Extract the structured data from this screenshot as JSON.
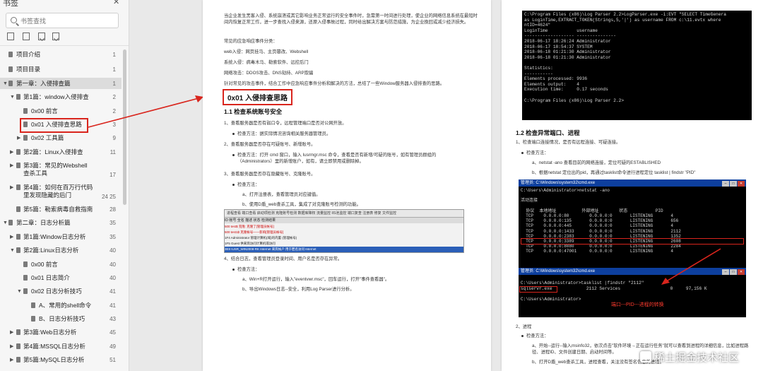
{
  "sidebar": {
    "title": "书签",
    "close": "✕",
    "search_placeholder": "书签查找",
    "items": [
      {
        "label": "项目介绍",
        "page": "1"
      },
      {
        "label": "项目目录",
        "page": "1"
      },
      {
        "label": "第一章：入侵排查篇",
        "page": "1"
      },
      {
        "label": "第1篇：window入侵排查",
        "page": "2"
      },
      {
        "label": "0x00 前言",
        "page": "2"
      },
      {
        "label": "0x01 入侵排查思路",
        "page": "3"
      },
      {
        "label": "0x02 工具篇",
        "page": "9"
      },
      {
        "label": "第2篇：Linux入侵排查",
        "page": "11"
      },
      {
        "label": "第3篇：常见的Webshell\n查杀工具",
        "page": "17"
      },
      {
        "label": "第4篇：如何在百万行代码\n里发现隐藏的后门",
        "page": "24\n25"
      },
      {
        "label": "第5篇：勒索病毒自救指南",
        "page": "28"
      },
      {
        "label": "第二章：日志分析篇",
        "page": "35"
      },
      {
        "label": "第1篇:Window日志分析",
        "page": "35"
      },
      {
        "label": "第2篇:Linux日志分析",
        "page": "40"
      },
      {
        "label": "0x00 前言",
        "page": "40"
      },
      {
        "label": "0x01 日志简介",
        "page": "40"
      },
      {
        "label": "0x02 日志分析技巧",
        "page": "41"
      },
      {
        "label": "A、常用的shell命令",
        "page": "41"
      },
      {
        "label": "B、日志分析技巧",
        "page": "43"
      },
      {
        "label": "第3篇:Web日志分析",
        "page": "45"
      },
      {
        "label": "第4篇:MSSQL日志分析",
        "page": "49"
      },
      {
        "label": "第5篇:MySQL日志分析",
        "page": "51"
      }
    ]
  },
  "page1": {
    "intro": "当企业发生黑客入侵、系统崩溃或其它影响业务正常运行的安全事件时，急需第一时间进行处理，使企业的网络信息系统在最短时间内恢复正常工作，进一步查找入侵来源，还原入侵事故过程，同时给出解决方案与防范措施，为企业挽回或减少经济损失。",
    "events_title": "常见的应急响应事件分类：",
    "ev1": "web入侵：网页挂马、主页篡改、Webshell",
    "ev2": "系统入侵：病毒木马、勒索软件、远控后门",
    "ev3": "网络攻击：DDOS攻击、DNS劫持、ARP欺骗",
    "summary": "针对常见的攻击事件，结合工作中应急响应事件分析和解决的方法，总结了一些Window服务器入侵排查的思路。",
    "h1": "0x01 入侵排查思路",
    "h2": "1.1 检查系统账号安全",
    "s1": "1、查看服务器是否有弱口令，远程管理端口是否对公网开放。",
    "s1b": "检查方法：据实际情况咨询相关服务器管理员。",
    "s2": "2、查看服务器是否存在可疑账号、新增账号。",
    "s2b": "检查方法：打开 cmd 窗口，输入 lusrmgr.msc 命令，查看是否有新增/可疑的账号，如有管理员群组的（Administrators）里的新增账户，如有，请立即禁用或删除掉。",
    "s3": "3、查看服务器是否存在隐藏账号、克隆账号。",
    "s3b": "检查方法：",
    "s3c": "a、打开注册表，查看管理员对应键值。",
    "s3d": "b、使用D盾_web查杀工具，集成了对克隆账号检测的功能。",
    "tbl_toolbar": "进程查看  端口查看  启动项检测  克隆账号检测  数据库降权  流量监控  IIS池监控  端口复查  注册表  修复  文件监控",
    "tbl_header": "ID   帐号          全名          描述                    状态  检测结果",
    "tbl_rows": [
      "500  test$                                                  克隆: 克隆了[管理员帐号]",
      "500  test1$                                                 克隆帐号——影响[管理员帐号]",
      "1F4  Administrator              管理计算机(域)的内置    (管理帐号)",
      "1F5  Guest                      供来宾访问计算机或访问",
      "3E8  IUSR_WIN2008-RK    Internet 来宾帐户    用于匿名访问 Internet"
    ],
    "tbl_note": "克隆：克隆了[管理员帐号]\n克隆帐号——影响[管理员帐号]",
    "s4": "4、结合日志，查看管理员登录时间、用户名是否存在异常。",
    "s4b": "检查方法：",
    "s4c": "a、Win+R打开运行，输入\"eventvwr.msc\"，回车运行，打开\"事件查看器\"。",
    "s4d": "b、导出Windows日志--安全，利用Log Parser进行分析。"
  },
  "page2": {
    "console1": "C:\\Program Files (x86)\\Log Parser 2.2>LogParser.exe -i:EVT \"SELECT TimeGenera\nas LoginTime,EXTRACT_TOKEN(Strings,5,'|') as username FROM c:\\11.evtx where\nntID=4624\"\nLoginTime           username\n------------------- ---------------\n2018-06-17 18:26:24 Administrator\n2018-06-17 18:54:37 SYSTEM\n2018-06-18 01:21:30 Administrator\n2018-06-18 01:21:30 Administrator\n\nStatistics:\n-----------\nElements processed: 9936\nElements output:    4\nExecution time:     0.17 seconds\n\nC:\\Program Files (x86)\\Log Parser 2.2>",
    "h2": "1.2 检查异常端口、进程",
    "p1": "1、检查端口连接情况，是否有远程连接、可疑连接。",
    "p1b": "检查方法：",
    "p1c": "a、netstat -ano 查看目前的网络连接，定位可疑的ESTABLISHED",
    "p1d": "b、根据netstat 定位出的pid，再通过tasklist命令进行进程定位 tasklist | findstr \"PID\"",
    "cmd2_title": "管理员: C:\\Windows\\system32\\cmd.exe",
    "console2": "C:\\Users\\Administrator>netstat -ano\n\n活动连接\n\n  协议  本地地址          外部地址        状态           PID\n  TCP    0.0.0.0:80        0.0.0.0:0       LISTENING       4\n  TCP    0.0.0.0:135       0.0.0.0:0       LISTENING       656\n  TCP    0.0.0.0:445       0.0.0.0:0       LISTENING       4\n  TCP    0.0.0.0:1433      0.0.0.0:0       LISTENING       2112\n  TCP    0.0.0.0:2383      0.0.0.0:0       LISTENING       1352\n  TCP    0.0.0.0:3389      0.0.0.0:0       LISTENING       2608\n  TCP    0.0.0.0:8080      0.0.0.0:0       LISTENING       2284\n  TCP    0.0.0.0:47001     0.0.0.0:0       LISTENING       4",
    "cmd3_title": "管理员: C:\\Windows\\system32\\cmd.exe",
    "console3": "C:\\Users\\Administrator>tasklist |findstr \"2112\"\nsqlservr.exe             2112 Services                   0     97,156 K\n\nC:\\Users\\Administrator>",
    "note": "端口---PID---进程的转换",
    "p2": "2、进程",
    "p2b": "检查方法：",
    "p2c": "a、开始--运行--输入msinfo32，依次点击\"软件环境→正在运行任务\"就可以查看到进程的详细信息，比如进程路径、进程ID、文件创建日期、启动时间等。",
    "p2d": "b、打开D盾_web查杀工具，进程查看，关注没有签名信息的进程。",
    "watermark": "稀土掘金技术社区"
  }
}
